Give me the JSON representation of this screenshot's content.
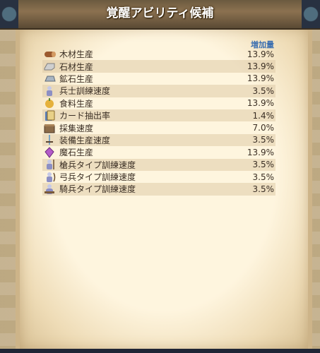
{
  "title": "覚醒アビリティ候補",
  "column_header": "増加量",
  "rows": [
    {
      "name": "木材生産",
      "value": "13.9%",
      "icon": "wood-log-icon",
      "color": "#9b5a2f"
    },
    {
      "name": "石材生産",
      "value": "13.9%",
      "icon": "stone-block-icon",
      "color": "#cfcfcf"
    },
    {
      "name": "鉱石生産",
      "value": "13.9%",
      "icon": "ore-ingot-icon",
      "color": "#a9b5c2"
    },
    {
      "name": "兵士訓練速度",
      "value": "3.5%",
      "icon": "soldier-icon",
      "color": "#8c8fc4"
    },
    {
      "name": "食料生産",
      "value": "13.9%",
      "icon": "food-icon",
      "color": "#e5b13c"
    },
    {
      "name": "カード抽出率",
      "value": "1.4%",
      "icon": "card-icon",
      "color": "#5a7fb8"
    },
    {
      "name": "採集速度",
      "value": "7.0%",
      "icon": "gathering-crate-icon",
      "color": "#8b6b48"
    },
    {
      "name": "装備生産速度",
      "value": "3.5%",
      "icon": "equipment-icon",
      "color": "#7aa6c6"
    },
    {
      "name": "魔石生産",
      "value": "13.9%",
      "icon": "magic-stone-icon",
      "color": "#b45cc9"
    },
    {
      "name": "槍兵タイプ訓練速度",
      "value": "3.5%",
      "icon": "spearman-icon",
      "color": "#8c8fc4"
    },
    {
      "name": "弓兵タイプ訓練速度",
      "value": "3.5%",
      "icon": "archer-icon",
      "color": "#8c8fc4"
    },
    {
      "name": "騎兵タイプ訓練速度",
      "value": "3.5%",
      "icon": "cavalry-icon",
      "color": "#8c8fc4"
    }
  ]
}
